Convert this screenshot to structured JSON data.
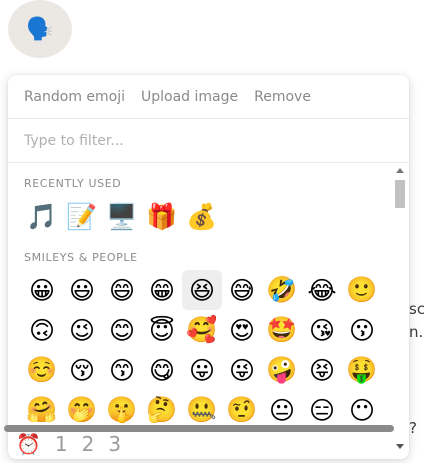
{
  "avatar": {
    "emoji": "🗣️"
  },
  "background_fragments": [
    "sc",
    "n.",
    "?"
  ],
  "tabs": [
    "Random emoji",
    "Upload image",
    "Remove"
  ],
  "filter": {
    "placeholder": "Type to filter..."
  },
  "sections": {
    "recent": {
      "title": "RECENTLY USED",
      "emojis": [
        "🎵",
        "📝",
        "🖥️",
        "🎁",
        "💰"
      ]
    },
    "smileys": {
      "title": "SMILEYS & PEOPLE",
      "rows": [
        [
          "😀",
          "😃",
          "😄",
          "😁",
          "😆",
          "😅",
          "🤣",
          "😂",
          "🙂"
        ],
        [
          "🙃",
          "😉",
          "😊",
          "😇",
          "🥰",
          "😍",
          "🤩",
          "😘",
          "😗"
        ],
        [
          "☺️",
          "😚",
          "😙",
          "😋",
          "😛",
          "😜",
          "🤪",
          "😝",
          "🤑"
        ],
        [
          "🤗",
          "🤭",
          "🤫",
          "🤔",
          "🤐",
          "🤨",
          "😐",
          "😑",
          "😶"
        ]
      ]
    }
  },
  "footer": {
    "icon": "⏰",
    "pages": [
      "1",
      "2",
      "3"
    ]
  }
}
